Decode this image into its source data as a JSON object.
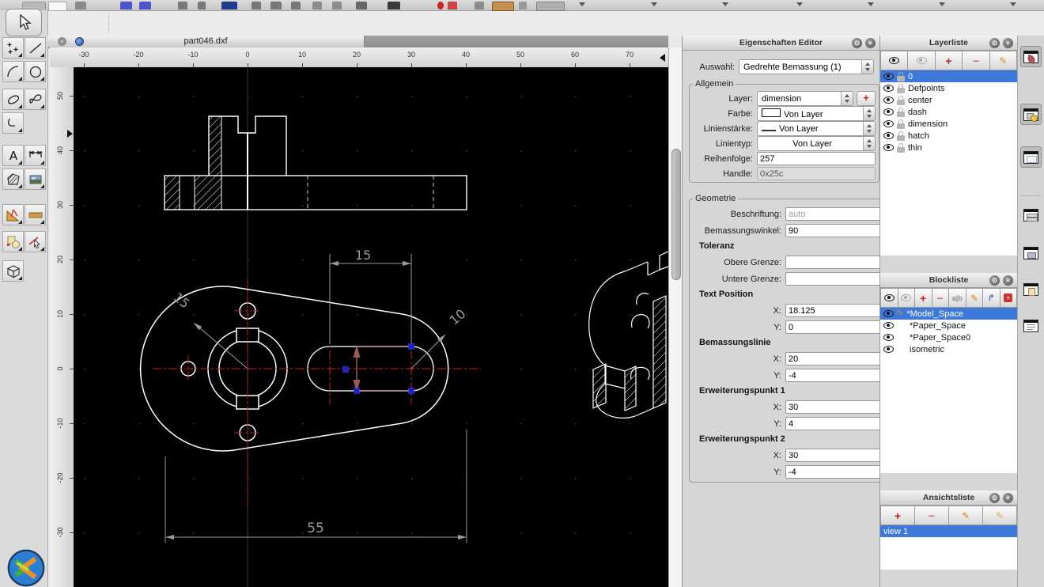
{
  "tab_bar": {
    "title": "part046.dxf",
    "close_glyph": "×"
  },
  "rulers": {
    "h": [
      "-30",
      "-20",
      "-10",
      "0",
      "10",
      "20",
      "30",
      "40",
      "50",
      "60",
      "70"
    ],
    "v": [
      "50",
      "40",
      "30",
      "20",
      "10",
      "0",
      "-10",
      "-20",
      "-30"
    ]
  },
  "canvas": {
    "dim_top": "15",
    "dim_radius_left": "15",
    "dim_radius_right": "10",
    "dim_bottom": "55"
  },
  "left_toolbar": {
    "tools": [
      "selection",
      "point",
      "line",
      "arc",
      "circle",
      "ellipse",
      "spline",
      "polyline",
      "text",
      "dimension",
      "hatch",
      "image",
      "measure",
      "ruler",
      "modify",
      "pick-entity",
      "solid"
    ]
  },
  "glyphs": {
    "plus": "+",
    "minus": "−",
    "pencil": "✎",
    "ab": "a|b",
    "arrow": "↱",
    "close": "×",
    "detach": "⊙",
    "redx": "×",
    "clear": "×"
  },
  "properties_editor": {
    "title": "Eigenschaften Editor",
    "selection_label": "Auswahl:",
    "selection_value": "Gedrehte Bemassung (1)",
    "general": {
      "legend": "Allgemein",
      "layer_label": "Layer:",
      "layer_value": "dimension",
      "color_label": "Farbe:",
      "color_value": "Von Layer",
      "lineweight_label": "Linienstärke:",
      "lineweight_value": "Von Layer",
      "linetype_label": "Linientyp:",
      "linetype_value": "Von Layer",
      "draworder_label": "Reihenfolge:",
      "draworder_value": "257",
      "handle_label": "Handle:",
      "handle_value": "0x25c"
    },
    "geometry": {
      "legend": "Geometrie",
      "label_label": "Beschriftung:",
      "label_placeholder": "auto",
      "angle_label": "Bemassungswinkel:",
      "angle_value": "90",
      "tolerance_header": "Toleranz",
      "upper_label": "Obere Grenze:",
      "lower_label": "Untere Grenze:",
      "textpos_header": "Text Position",
      "x_label": "X:",
      "y_label": "Y:",
      "textpos_x": "18.125",
      "textpos_y": "0",
      "dimline_header": "Bemassungslinie",
      "dimline_x": "20",
      "dimline_y": "-4",
      "ext1_header": "Erweiterungspunkt 1",
      "ext1_x": "30",
      "ext1_y": "4",
      "ext2_header": "Erweiterungspunkt 2",
      "ext2_x": "30",
      "ext2_y": "-4"
    }
  },
  "layer_list": {
    "title": "Layerliste",
    "layers": [
      {
        "name": "0",
        "selected": true
      },
      {
        "name": "Defpoints"
      },
      {
        "name": "center"
      },
      {
        "name": "dash"
      },
      {
        "name": "dimension"
      },
      {
        "name": "hatch"
      },
      {
        "name": "thin"
      }
    ]
  },
  "block_list": {
    "title": "Blockliste",
    "blocks": [
      {
        "name": "*Model_Space",
        "selected": true
      },
      {
        "name": "*Paper_Space"
      },
      {
        "name": "*Paper_Space0"
      },
      {
        "name": "isometric"
      }
    ]
  },
  "view_list": {
    "title": "Ansichtsliste",
    "views": [
      {
        "name": "view 1",
        "selected": true
      }
    ]
  },
  "right_toolbar": {
    "icons": [
      "property-editor-window",
      "layer-list-window",
      "block-list-window",
      "library-browser-window",
      "command-line-window",
      "clipboard-window",
      "script-text-window"
    ]
  },
  "colors": {
    "selection_highlight": "#3e79da",
    "grip_blue": "#1f1fcf",
    "selected_entity": "#9d5a5a",
    "centerline_red": "#c81e1e",
    "drawing_white": "#ffffff",
    "dimension_gray": "#9a9a9a",
    "canvas_bg": "#000000",
    "add_red": "#c42222",
    "pencil_orange": "#d78c1e"
  }
}
